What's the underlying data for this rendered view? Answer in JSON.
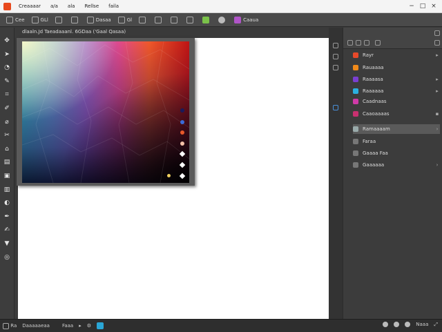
{
  "titlebar": {
    "app_name": "Creaaaar",
    "menu": [
      "a/a",
      "ala",
      "Rellse",
      "faila"
    ],
    "controls": [
      "−",
      "□",
      "×"
    ]
  },
  "toolbar": {
    "items": [
      {
        "icon": "new-file-icon",
        "label": "Cee"
      },
      {
        "icon": "settings-icon",
        "label": "GLl"
      },
      {
        "icon": "selection-icon",
        "label": ""
      },
      {
        "icon": "brush-icon",
        "label": ""
      },
      {
        "icon": "document-icon",
        "label": "Dasaa"
      },
      {
        "icon": "crop-icon",
        "label": "Gl"
      },
      {
        "icon": "globe-icon",
        "label": ""
      },
      {
        "icon": "hand-icon",
        "label": ""
      },
      {
        "icon": "image-icon",
        "label": ""
      },
      {
        "icon": "layers-icon",
        "label": ""
      },
      {
        "icon": "green-square-icon",
        "label": ""
      },
      {
        "icon": "circle-icon",
        "label": ""
      },
      {
        "icon": "purple-square-icon",
        "label": "Caaua"
      }
    ]
  },
  "document_tab": {
    "label": "dlaaln.Jd   Taeadaaanl. 6GDaa ('Gaal Qasaa)"
  },
  "tools": [
    {
      "icon": "move-icon",
      "glyph": "✥"
    },
    {
      "icon": "arrow-icon",
      "glyph": "➤"
    },
    {
      "icon": "lasso-icon",
      "glyph": "◔"
    },
    {
      "icon": "wand-icon",
      "glyph": "✎"
    },
    {
      "icon": "crop-tool-icon",
      "glyph": "⌗"
    },
    {
      "icon": "eyedropper-icon",
      "glyph": "✐"
    },
    {
      "icon": "heal-icon",
      "glyph": "⌀"
    },
    {
      "icon": "brush-tool-icon",
      "glyph": "✂"
    },
    {
      "icon": "stamp-icon",
      "glyph": "⌂"
    },
    {
      "icon": "history-icon",
      "glyph": "▤"
    },
    {
      "icon": "eraser-icon",
      "glyph": "▣"
    },
    {
      "icon": "gradient-icon",
      "glyph": "▥"
    },
    {
      "icon": "blur-icon",
      "glyph": "◐"
    },
    {
      "icon": "pen-icon",
      "glyph": "✒"
    },
    {
      "icon": "type-icon",
      "glyph": "✍"
    },
    {
      "icon": "path-icon",
      "glyph": "▼"
    },
    {
      "icon": "shape-icon",
      "glyph": "◎"
    }
  ],
  "layers_panel": {
    "layers": [
      {
        "icon": "red-layer-icon",
        "color": "#e8492a",
        "label": "Rayr",
        "arrow": "▸"
      },
      {
        "icon": "orange-layer-icon",
        "color": "#f08a1a",
        "label": "Rauaaaa",
        "arrow": ""
      },
      {
        "icon": "purple-layer-icon",
        "color": "#7a3fd0",
        "label": "Raaaasa",
        "arrow": "▸"
      },
      {
        "icon": "cyan-layer-icon",
        "color": "#2bb0e0",
        "label": "Raaaaaa",
        "arrow": "▸"
      },
      {
        "icon": "magenta-layer-icon",
        "color": "#d03aa8",
        "label": "Caadnaas",
        "arrow": ""
      },
      {
        "icon": "pink-layer-icon",
        "color": "#c83070",
        "label": "Caaoaaaas",
        "arrow": "▪"
      },
      {
        "icon": "mask-layer-icon",
        "color": "#9aa",
        "label": "Ramaaaam",
        "arrow": "›"
      },
      {
        "icon": "adjust-layer-icon",
        "color": "#777",
        "label": "Faraa",
        "arrow": ""
      },
      {
        "icon": "group-layer-icon",
        "color": "#777",
        "label": "Gaaaa Faa",
        "arrow": ""
      },
      {
        "icon": "effects-layer-icon",
        "color": "#777",
        "label": "Gaaaaaa",
        "arrow": "›"
      }
    ]
  },
  "statusbar": {
    "zoom": "Ra",
    "doc_info": "Daaaaaeaa",
    "mode": "Faaa",
    "right_label": "Naaa"
  }
}
